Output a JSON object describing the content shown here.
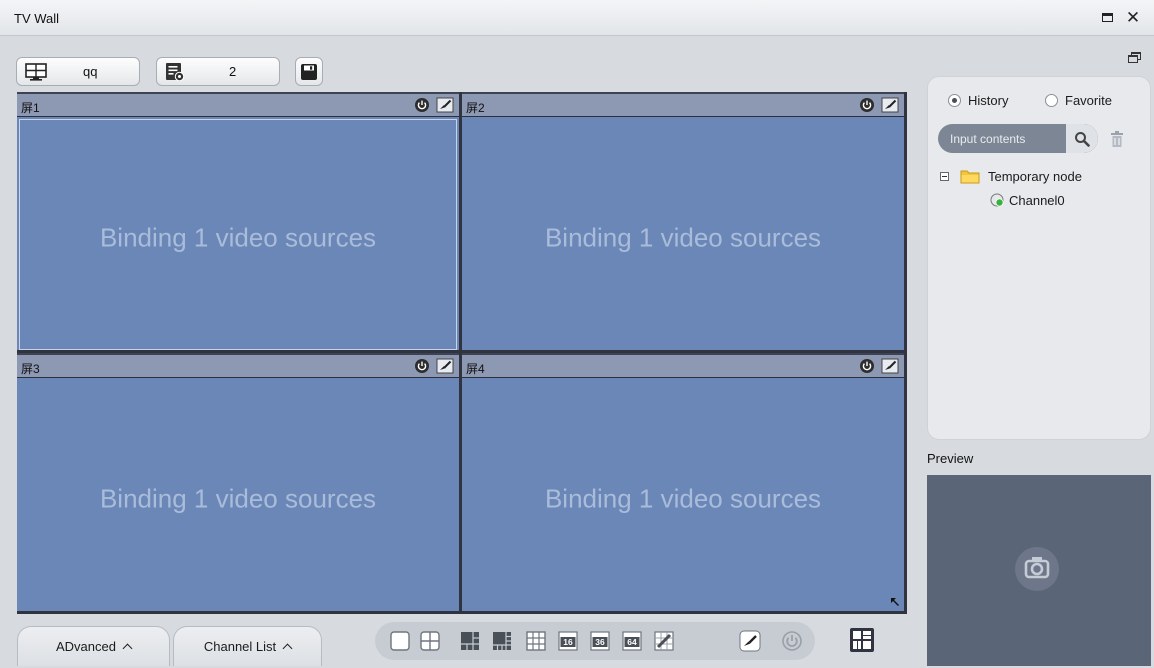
{
  "window": {
    "title": "TV Wall"
  },
  "toolbar": {
    "monitor_label": "qq",
    "plan_label": "2"
  },
  "wall": {
    "screens": [
      {
        "name": "屏1",
        "status": "Binding 1 video sources"
      },
      {
        "name": "屏2",
        "status": "Binding 1 video sources"
      },
      {
        "name": "屏3",
        "status": "Binding 1 video sources"
      },
      {
        "name": "屏4",
        "status": "Binding 1 video sources"
      }
    ]
  },
  "side_panel": {
    "history_label": "History",
    "favorite_label": "Favorite",
    "selected": "History",
    "search_placeholder": "Input contents",
    "tree": {
      "node_label": "Temporary node",
      "children": [
        "Channel0"
      ]
    }
  },
  "preview": {
    "label": "Preview"
  },
  "bottom": {
    "advanced_label": "ADvanced",
    "channel_list_label": "Channel List",
    "layouts": [
      "1",
      "4",
      "6",
      "8",
      "9",
      "16",
      "36",
      "64",
      "custom",
      "clear",
      "power"
    ]
  },
  "colors": {
    "screen_fill": "#6b87b7",
    "screen_text": "#a9bcd9",
    "preview_bg": "#5b6578"
  }
}
